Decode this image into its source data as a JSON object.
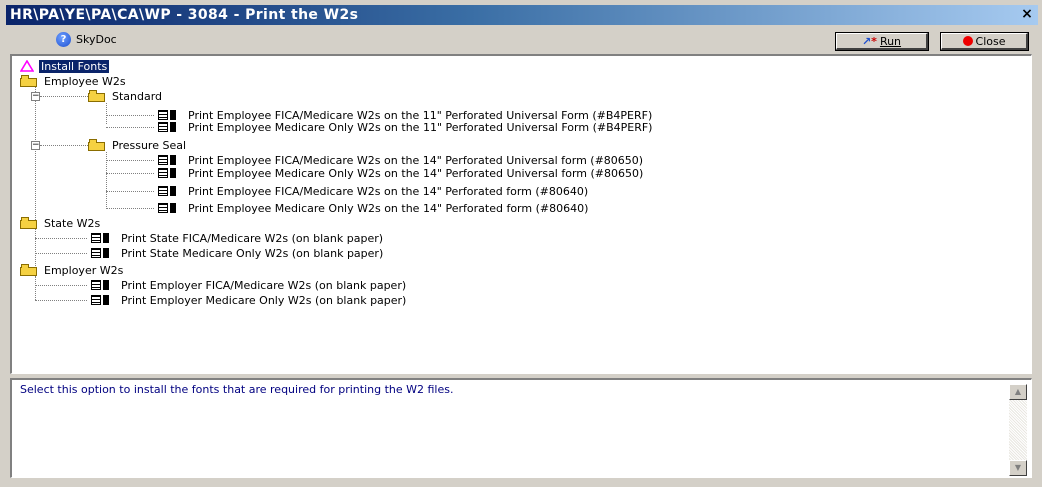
{
  "window": {
    "title": "HR\\PA\\YE\\PA\\CA\\WP - 3084 - Print the W2s",
    "close_glyph": "×"
  },
  "toolbar": {
    "help_label": "SkyDoc",
    "run_label": "Run",
    "close_label": "Close"
  },
  "tree": {
    "root_item": "Install Fonts",
    "employee_w2s": {
      "label": "Employee W2s",
      "standard": {
        "label": "Standard",
        "items": [
          "Print Employee FICA/Medicare W2s on the 11\" Perforated Universal Form (#B4PERF)",
          "Print Employee Medicare Only W2s on the 11\" Perforated Universal Form (#B4PERF)"
        ]
      },
      "pressure_seal": {
        "label": "Pressure Seal",
        "items": [
          "Print Employee FICA/Medicare W2s on the 14\" Perforated Universal form (#80650)",
          "Print Employee Medicare Only W2s on the 14\" Perforated Universal form (#80650)",
          "Print Employee FICA/Medicare W2s on the 14\" Perforated form (#80640)",
          "Print Employee Medicare Only W2s on the 14\" Perforated form (#80640)"
        ]
      }
    },
    "state_w2s": {
      "label": "State W2s",
      "items": [
        "Print State FICA/Medicare W2s (on blank paper)",
        "Print State Medicare Only W2s (on blank paper)"
      ]
    },
    "employer_w2s": {
      "label": "Employer W2s",
      "items": [
        "Print Employer FICA/Medicare W2s (on blank paper)",
        "Print Employer Medicare Only W2s (on blank paper)"
      ]
    }
  },
  "description": {
    "text": "Select this option to install the fonts that are required for printing the W2 files."
  },
  "colors": {
    "title_bar": "#0a246a",
    "selection": "#0a246a",
    "description_text": "#000080",
    "folder": "#f5d142",
    "triangle": "#ff00ff"
  }
}
